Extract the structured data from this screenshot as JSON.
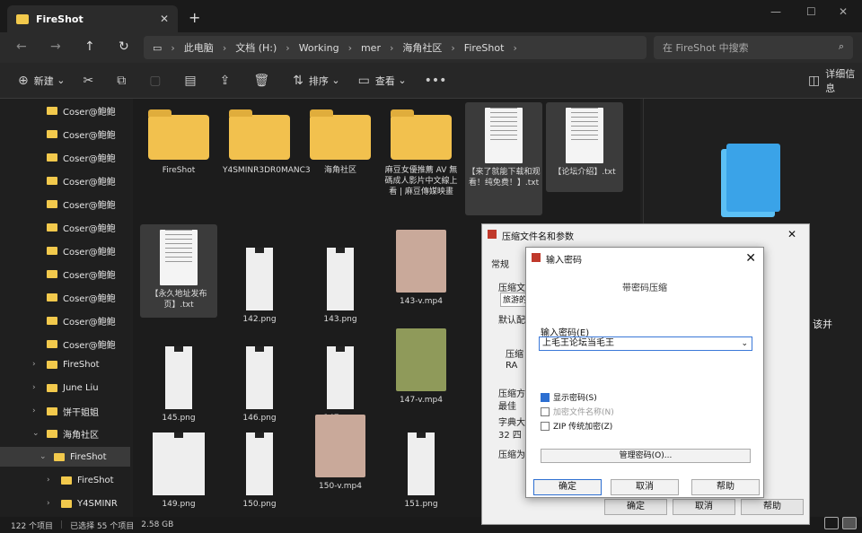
{
  "tab": {
    "title": "FireShot"
  },
  "breadcrumbs": [
    "此电脑",
    "文档 (H:)",
    "Working",
    "mer",
    "海角社区",
    "FireShot"
  ],
  "search": {
    "placeholder": "在 FireShot 中搜索"
  },
  "commands": {
    "new": "新建",
    "sort": "排序",
    "view": "查看",
    "details": "详细信息"
  },
  "sidebar": {
    "items": [
      {
        "label": "Coser@鲍鲍"
      },
      {
        "label": "Coser@鲍鲍"
      },
      {
        "label": "Coser@鲍鲍"
      },
      {
        "label": "Coser@鲍鲍"
      },
      {
        "label": "Coser@鲍鲍"
      },
      {
        "label": "Coser@鲍鲍"
      },
      {
        "label": "Coser@鲍鲍"
      },
      {
        "label": "Coser@鲍鲍"
      },
      {
        "label": "Coser@鲍鲍"
      },
      {
        "label": "Coser@鲍鲍"
      },
      {
        "label": "Coser@鲍鲍"
      },
      {
        "label": "FireShot"
      },
      {
        "label": "June Liu"
      },
      {
        "label": "饼干姐姐"
      },
      {
        "label": "海角社区"
      },
      {
        "label": "FireShot"
      },
      {
        "label": "FireShot"
      },
      {
        "label": "Y4SMINR"
      }
    ]
  },
  "files": [
    {
      "name": "FireShot",
      "kind": "folder"
    },
    {
      "name": "Y4SMINR3DR0MANC3",
      "kind": "folder"
    },
    {
      "name": "海角社区",
      "kind": "folder"
    },
    {
      "name": "麻豆女優推薦 AV 無碼成人影片中文線上看 | 麻豆傳媒映畫",
      "kind": "folder"
    },
    {
      "name": "【来了就能下载和观看！纯免费！】.txt",
      "kind": "txt"
    },
    {
      "name": "【论坛介绍】.txt",
      "kind": "txt"
    },
    {
      "name": "【永久地址发布页】.txt",
      "kind": "txt"
    },
    {
      "name": "142.png",
      "kind": "png"
    },
    {
      "name": "143.png",
      "kind": "png"
    },
    {
      "name": "143-v.mp4",
      "kind": "vid"
    },
    {
      "name": "145.png",
      "kind": "png"
    },
    {
      "name": "146.png",
      "kind": "png"
    },
    {
      "name": "147.png",
      "kind": "png"
    },
    {
      "name": "147-v.mp4",
      "kind": "vidg"
    },
    {
      "name": "149.png",
      "kind": "png"
    },
    {
      "name": "150.png",
      "kind": "png"
    },
    {
      "name": "150-v.mp4",
      "kind": "vid"
    },
    {
      "name": "151.png",
      "kind": "png"
    }
  ],
  "preview": {
    "text": "该并"
  },
  "status": {
    "count": "122 个项目",
    "selected": "已选择 55 个项目",
    "size": "2.58 GB"
  },
  "archive_dialog": {
    "title": "压缩文件名和参数",
    "tab_general": "常规",
    "lbl_name": "压缩文",
    "field_name": "旅游的",
    "lbl_default": "默认配",
    "lbl_format": "压缩",
    "radio_rar": "RA",
    "lbl_method": "压缩方",
    "value_method": "最佳",
    "lbl_dict": "字典大",
    "value_dict": "32 四",
    "lbl_split": "压缩为",
    "btn_ok": "确定",
    "btn_cancel": "取消",
    "btn_help": "帮助"
  },
  "password_dialog": {
    "title": "输入密码",
    "heading": "带密码压缩",
    "label": "输入密码(E)",
    "value": "上毛王论坛当毛王",
    "show_password": "显示密码(S)",
    "encrypt_names": "加密文件名称(N)",
    "zip_legacy": "ZIP 传统加密(Z)",
    "manage": "管理密码(O)...",
    "ok": "确定",
    "cancel": "取消",
    "help": "帮助"
  }
}
